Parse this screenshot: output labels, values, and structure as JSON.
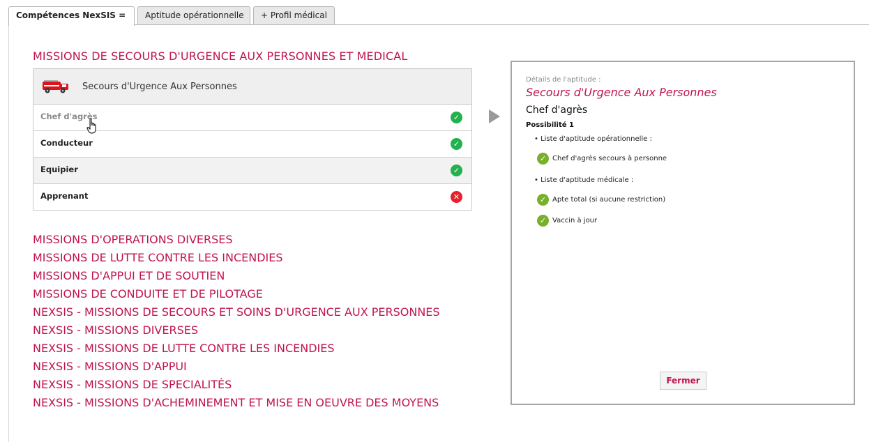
{
  "tabs": [
    {
      "label": "Compétences NexSIS ="
    },
    {
      "label": "Aptitude opérationnelle"
    },
    {
      "label": "+ Profil médical"
    }
  ],
  "main_mission": {
    "title": "MISSIONS DE SECOURS D'URGENCE AUX PERSONNES ET MEDICAL",
    "category": "Secours d'Urgence Aux Personnes",
    "roles": [
      {
        "label": "Chef d'agrès",
        "status": "ok"
      },
      {
        "label": "Conducteur",
        "status": "ok"
      },
      {
        "label": "Equipier",
        "status": "ok"
      },
      {
        "label": "Apprenant",
        "status": "ko"
      }
    ]
  },
  "missions": [
    "MISSIONS D'OPERATIONS DIVERSES",
    "MISSIONS DE LUTTE CONTRE LES INCENDIES",
    "MISSIONS D'APPUI ET DE SOUTIEN",
    "MISSIONS DE CONDUITE ET DE PILOTAGE",
    "NEXSIS - MISSIONS DE SECOURS ET SOINS D'URGENCE AUX PERSONNES",
    "NEXSIS - MISSIONS DIVERSES",
    "NEXSIS - MISSIONS DE LUTTE CONTRE LES INCENDIES",
    "NEXSIS - MISSIONS D'APPUI",
    "NEXSIS - MISSIONS DE SPECIALITÉS",
    "NEXSIS - MISSIONS D'ACHEMINEMENT ET MISE EN OEUVRE DES MOYENS"
  ],
  "detail": {
    "caption": "Détails de l'aptitude :",
    "title": "Secours d'Urgence Aux Personnes",
    "role": "Chef d'agrès",
    "possibility": "Possibilité 1",
    "operational_label": "• Liste d'aptitude opérationnelle :",
    "operational_items": [
      "Chef d'agrès secours à personne"
    ],
    "medical_label": "• Liste d'aptitude médicale :",
    "medical_items": [
      "Apte total (si aucune restriction)",
      "Vaccin à jour"
    ],
    "close_label": "Fermer"
  },
  "colors": {
    "accent": "#c0144e",
    "ok": "#22b14c",
    "ko": "#e8202c",
    "check": "#78b02a"
  }
}
